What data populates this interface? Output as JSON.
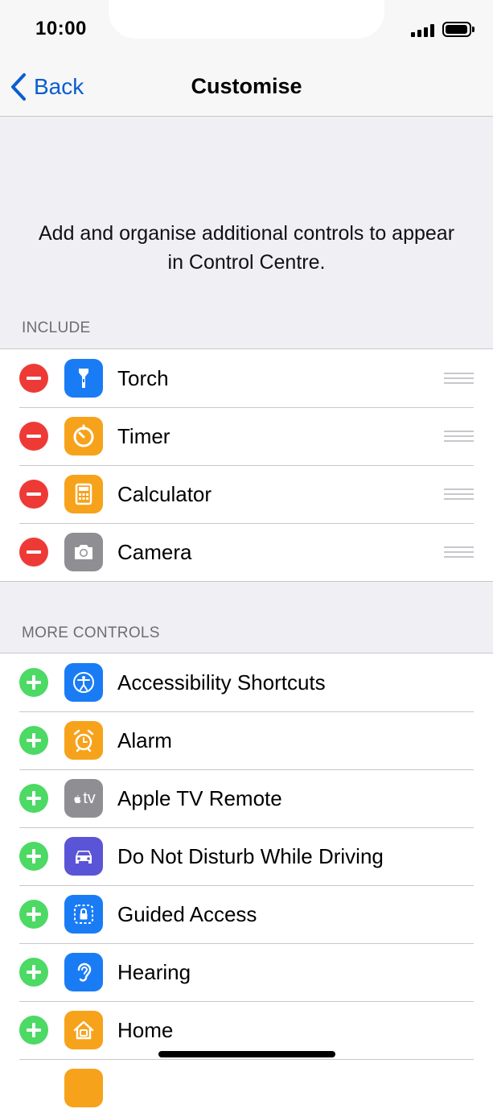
{
  "status_bar": {
    "time": "10:00"
  },
  "nav": {
    "back_label": "Back",
    "title": "Customise"
  },
  "description": "Add and organise additional controls to appear in Control Centre.",
  "include": {
    "header": "INCLUDE",
    "items": [
      {
        "label": "Torch",
        "icon": "torch-icon",
        "color": "#1a7cf5"
      },
      {
        "label": "Timer",
        "icon": "timer-icon",
        "color": "#f7a21b"
      },
      {
        "label": "Calculator",
        "icon": "calculator-icon",
        "color": "#f7a21b"
      },
      {
        "label": "Camera",
        "icon": "camera-icon",
        "color": "#8e8e93"
      }
    ]
  },
  "more": {
    "header": "MORE CONTROLS",
    "items": [
      {
        "label": "Accessibility Shortcuts",
        "icon": "accessibility-icon",
        "color": "#1a7cf5"
      },
      {
        "label": "Alarm",
        "icon": "alarm-icon",
        "color": "#f7a21b"
      },
      {
        "label": "Apple TV Remote",
        "icon": "apple-tv-icon",
        "color": "#8e8e93",
        "icon_text": "tv"
      },
      {
        "label": "Do Not Disturb While Driving",
        "icon": "car-icon",
        "color": "#5a55d6"
      },
      {
        "label": "Guided Access",
        "icon": "lock-icon",
        "color": "#1a7cf5"
      },
      {
        "label": "Hearing",
        "icon": "ear-icon",
        "color": "#1a7cf5"
      },
      {
        "label": "Home",
        "icon": "home-icon",
        "color": "#f7a21b"
      }
    ]
  },
  "colors": {
    "accent": "#0a5ecf",
    "remove": "#ee3a36",
    "add": "#4cd964"
  }
}
